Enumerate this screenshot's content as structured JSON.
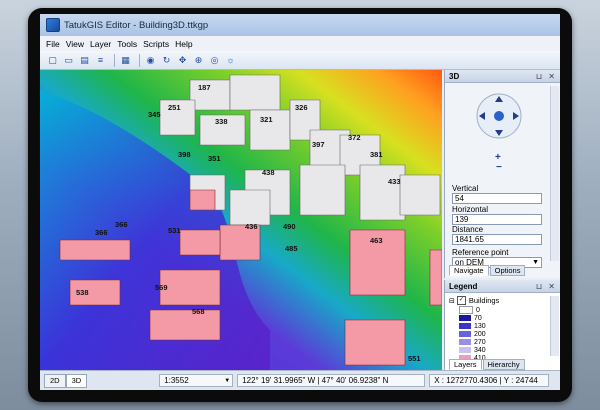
{
  "window": {
    "title": "TatukGIS Editor - Building3D.ttkgp"
  },
  "menu": {
    "items": [
      "File",
      "View",
      "Layer",
      "Tools",
      "Scripts",
      "Help"
    ]
  },
  "toolbar": {
    "icons": [
      "new-icon",
      "open-icon",
      "save-icon",
      "save-as-icon",
      "print-icon",
      "globe-icon",
      "rotate-icon",
      "pan-icon",
      "zoom-icon",
      "eye-icon",
      "light-icon"
    ]
  },
  "map": {
    "building_labels": [
      "187",
      "251",
      "345",
      "338",
      "321",
      "326",
      "398",
      "351",
      "397",
      "372",
      "381",
      "438",
      "433",
      "436",
      "490",
      "485",
      "463",
      "366",
      "366",
      "531",
      "538",
      "569",
      "568",
      "551"
    ],
    "colors": {
      "water": "#3a33d8",
      "low": "#8b3bd8",
      "ground": "#1fb54a",
      "hill": "#c8e020",
      "peak": "#ff6a00",
      "buildings_white": "#e8e8ea",
      "buildings_pink": "#f39aa6"
    }
  },
  "panel3d": {
    "title": "3D",
    "header_controls": "⊔ ✕",
    "vertical_label": "Vertical",
    "vertical_value": "54",
    "horizontal_label": "Horizontal",
    "horizontal_value": "139",
    "distance_label": "Distance",
    "distance_value": "1841.65",
    "reference_label": "Reference point",
    "reference_value": "on DEM",
    "tab_navigate": "Navigate",
    "tab_options": "Options"
  },
  "legend": {
    "title": "Legend",
    "header_controls": "⊔ ✕",
    "layer_name": "Buildings",
    "layer_checked": true,
    "entries": [
      "0",
      "70",
      "130",
      "200",
      "270",
      "340",
      "410"
    ],
    "entry_colors": [
      "#ffffff",
      "#1a16a0",
      "#3b35c8",
      "#6a62dc",
      "#9a8fe6",
      "#c9bff0",
      "#e8a0c0"
    ],
    "tab_layers": "Layers",
    "tab_hierarchy": "Hierarchy"
  },
  "status": {
    "tab_2d": "2D",
    "tab_3d": "3D",
    "scale": "1:3552",
    "coordinates": "122° 19' 31.9965\" W | 47° 40' 06.9238\" N",
    "xy": "X : 1272770.4306 | Y : 24744"
  }
}
